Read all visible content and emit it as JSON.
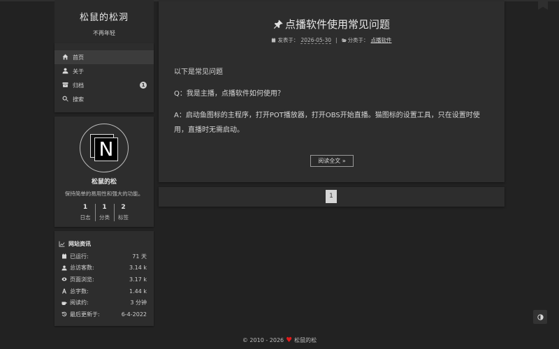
{
  "site": {
    "title": "松鼠的松洞",
    "subtitle": "不再年轻"
  },
  "menu": {
    "items": [
      {
        "label": "首页",
        "icon": "home-icon",
        "active": true
      },
      {
        "label": "关于",
        "icon": "user-icon"
      },
      {
        "label": "归档",
        "icon": "archive-icon",
        "badge": "1"
      },
      {
        "label": "搜索",
        "icon": "search-icon"
      }
    ]
  },
  "profile": {
    "avatar_letter": "N",
    "name": "松鼠的松",
    "description": "保持简单的易用性和强大的功能。",
    "stats": [
      {
        "num": "1",
        "label": "日志"
      },
      {
        "num": "1",
        "label": "分类"
      },
      {
        "num": "2",
        "label": "标签"
      }
    ]
  },
  "site_info": {
    "title": "网站资讯",
    "rows": [
      {
        "label": "已运行:",
        "value": "71 天",
        "icon": "calendar-icon"
      },
      {
        "label": "总访客数:",
        "value": "3.14 k",
        "icon": "user-icon"
      },
      {
        "label": "页面浏览:",
        "value": "3.17 k",
        "icon": "eye-icon"
      },
      {
        "label": "总字数:",
        "value": "1.44 k",
        "icon": "font-icon"
      },
      {
        "label": "阅读约:",
        "value": "3 分钟",
        "icon": "coffee-icon"
      },
      {
        "label": "最后更新于:",
        "value": "6-4-2022",
        "icon": "history-icon"
      }
    ]
  },
  "post": {
    "title": "点播软件使用常见问题",
    "meta_published_label": "发表于：",
    "meta_date": "2026-05-30",
    "meta_separator": "|",
    "meta_category_label": "分类于：",
    "meta_category": "点播软件",
    "paragraphs": [
      "以下是常见问题",
      "Q：我是主播，点播软件如何使用？",
      "A：启动鱼图标的主程序，打开POT播放器，打开OBS开始直播。猫图标的设置工具，只在设置时使用，直播时无需启动。"
    ],
    "read_more": "阅读全文 »"
  },
  "pagination": {
    "current": "1"
  },
  "footer": {
    "copyright": "© 2010 - 2026",
    "author": "松鼠的松",
    "heart_color": "#e21b1b"
  }
}
